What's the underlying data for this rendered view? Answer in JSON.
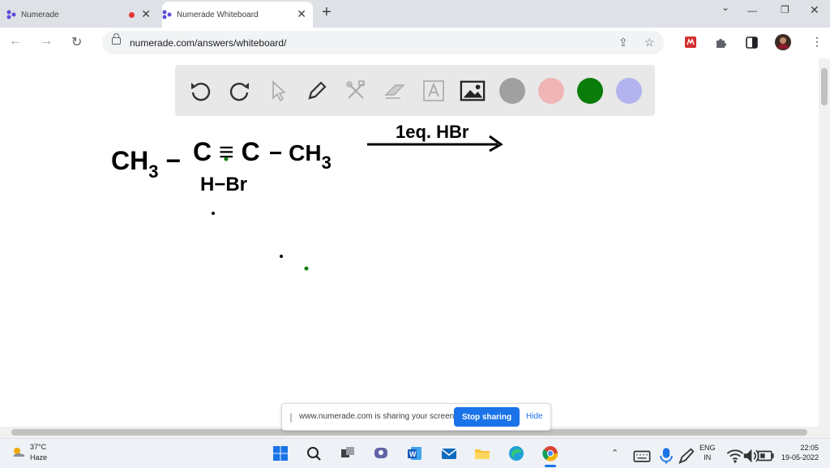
{
  "browser": {
    "tabs": [
      {
        "title": "Numerade",
        "recording": true
      },
      {
        "title": "Numerade Whiteboard",
        "active": true
      }
    ],
    "new_tab": "+",
    "address": "numerade.com/answers/whiteboard/"
  },
  "whiteboard": {
    "tools": [
      "undo-icon",
      "redo-icon",
      "pointer-icon",
      "pen-icon",
      "tools-icon",
      "eraser-icon",
      "text-icon",
      "image-icon"
    ],
    "colors": [
      "#a0a0a0",
      "#f2b5b5",
      "#0a7c0a",
      "#b3b3f0"
    ],
    "handwriting": {
      "reactant_left": "CH3 −",
      "alkyne": "C ≡ C",
      "reactant_right": "− CH3",
      "reagent": "1eq. HBr",
      "addend": "H−Br"
    }
  },
  "share_bar": {
    "message": "www.numerade.com is sharing your screen.",
    "stop_label": "Stop sharing",
    "hide_label": "Hide"
  },
  "taskbar": {
    "weather_temp": "37°C",
    "weather_cond": "Haze",
    "lang_top": "ENG",
    "lang_bottom": "IN",
    "time": "22:05",
    "date": "19-05-2022"
  }
}
